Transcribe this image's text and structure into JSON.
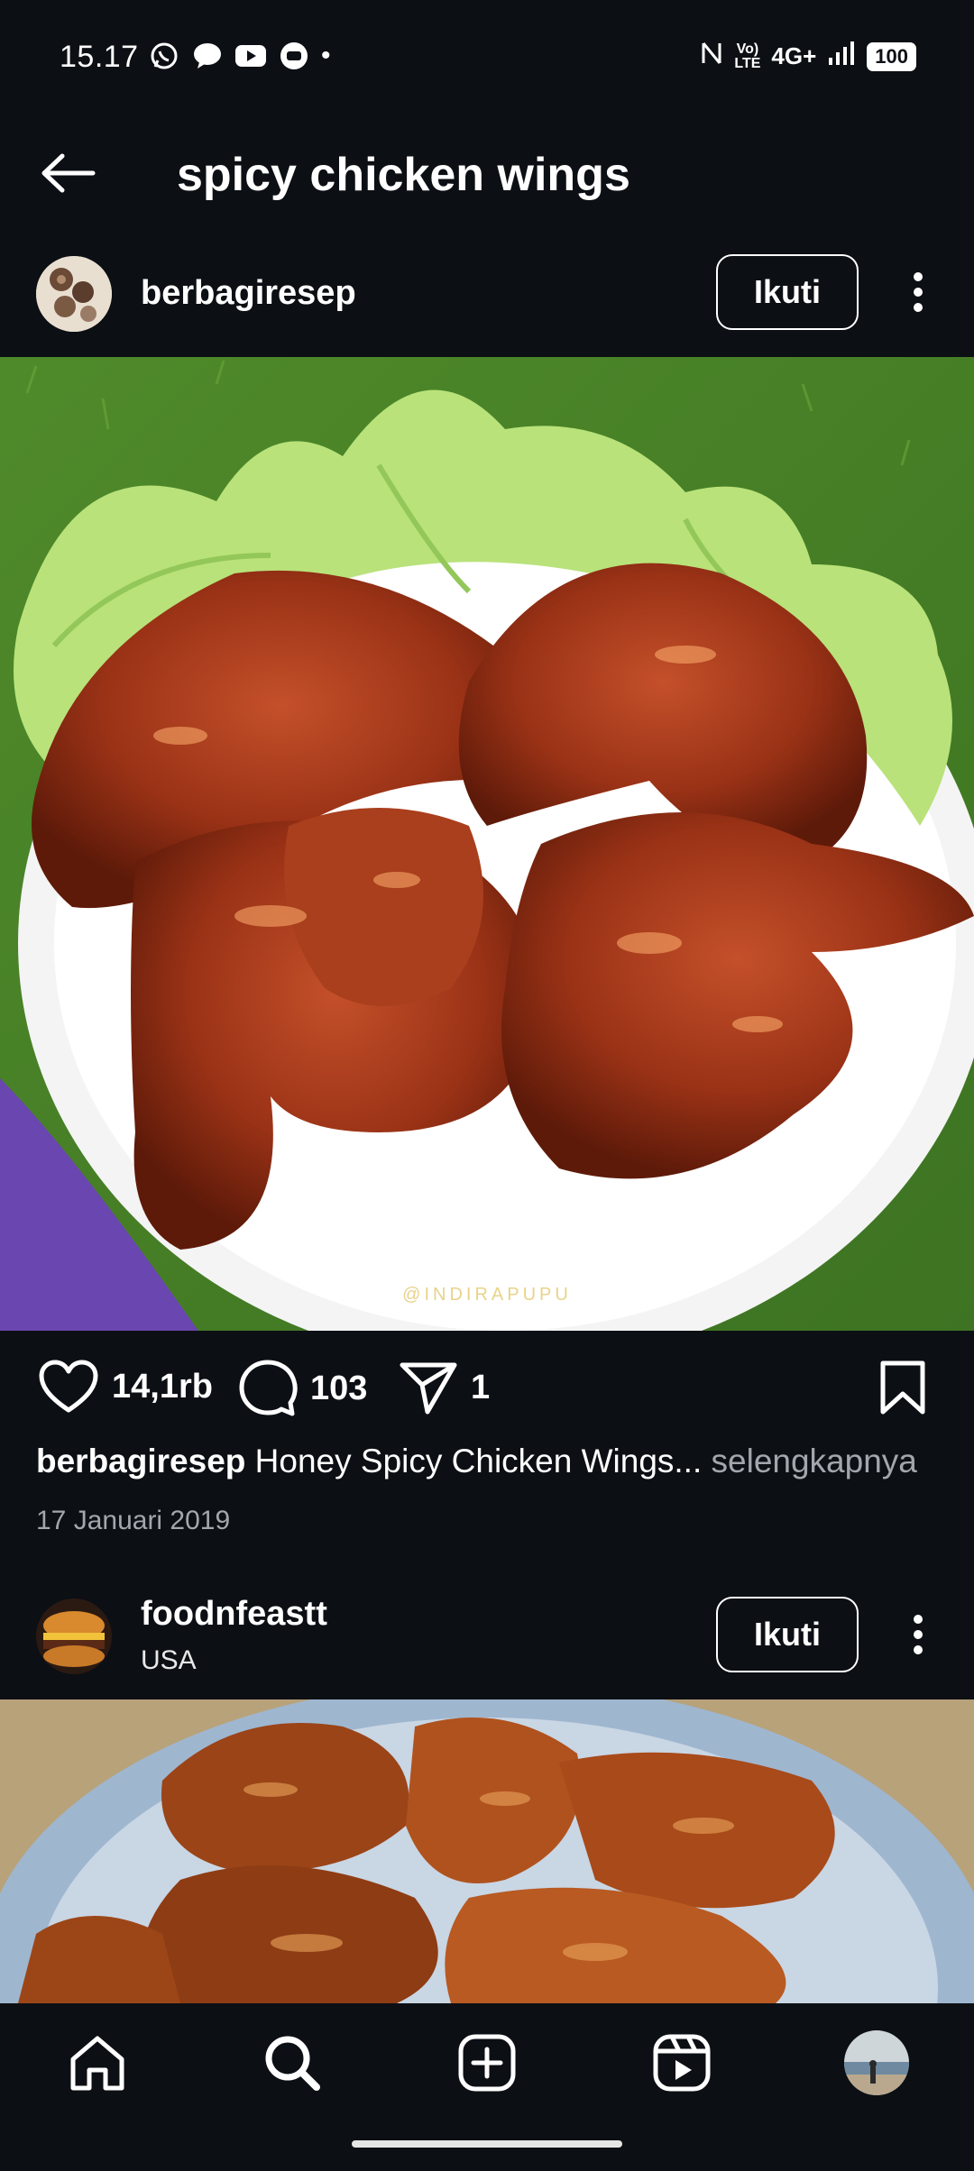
{
  "status_bar": {
    "time": "15.17",
    "dot": "•",
    "network": "4G+",
    "battery": "100",
    "left_icons": [
      "whatsapp-icon",
      "message-icon",
      "youtube-icon",
      "chat-icon"
    ],
    "right_icons": [
      "nfc-icon",
      "volte-icon",
      "signal-icon",
      "battery-icon"
    ]
  },
  "header": {
    "title": "spicy chicken wings",
    "back_icon": "arrow-left-icon"
  },
  "posts": [
    {
      "username": "berbagiresep",
      "location": "",
      "follow_label": "Ikuti",
      "image_watermark": "@INDIRAPUPU",
      "likes": "14,1rb",
      "comments": "103",
      "shares": "1",
      "caption_user": "berbagiresep",
      "caption_text": "Honey Spicy Chicken Wings...",
      "caption_more": "selengkapnya",
      "date": "17 Januari 2019"
    },
    {
      "username": "foodnfeastt",
      "location": "USA",
      "follow_label": "Ikuti"
    }
  ],
  "bottom_nav": [
    "home-icon",
    "search-icon",
    "create-icon",
    "reels-icon",
    "profile-avatar"
  ],
  "colors": {
    "background": "#0c0f14",
    "text": "#ffffff",
    "muted": "#a3a7ad"
  }
}
